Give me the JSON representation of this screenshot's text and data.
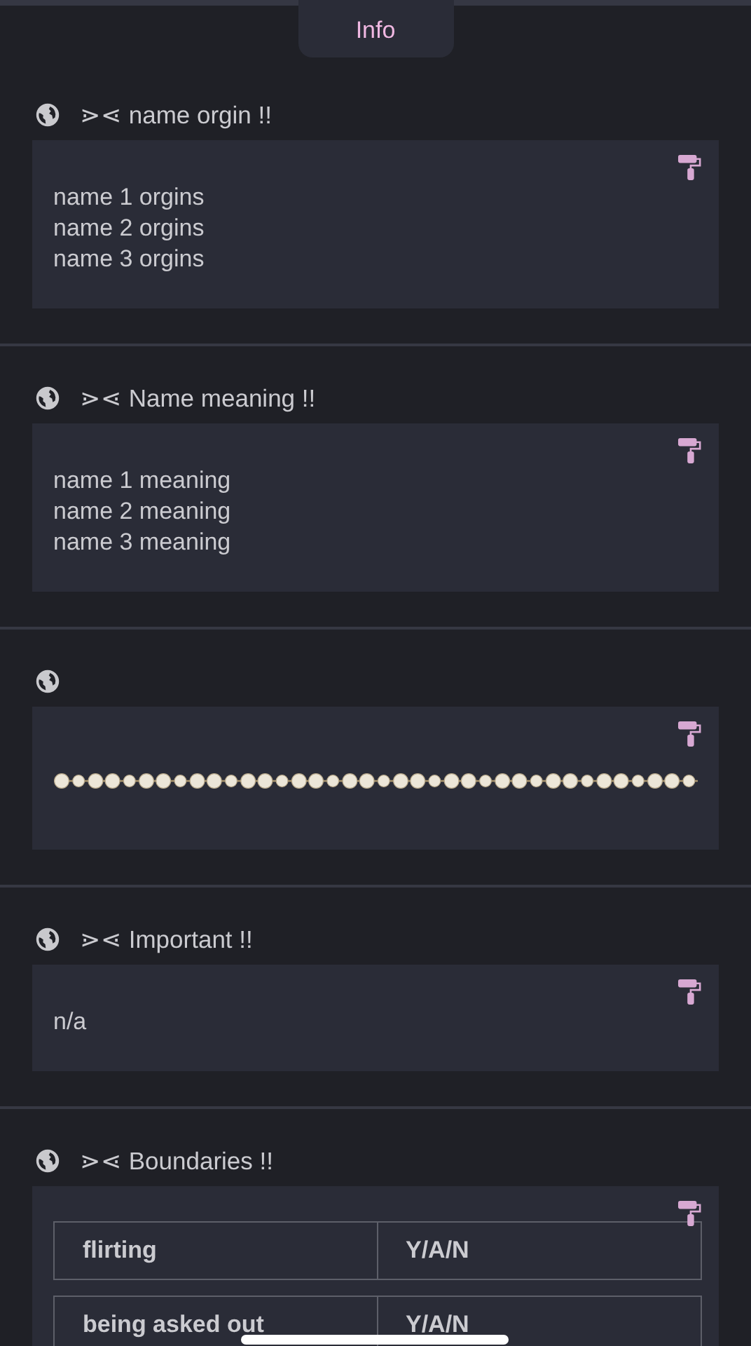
{
  "tab": {
    "label": "Info",
    "selected": true
  },
  "sections": [
    {
      "kind": "text",
      "title": "⋗⋖ name orgin !!",
      "lines": [
        "name 1 orgins",
        "name 2 orgins",
        "name 3 orgins"
      ]
    },
    {
      "kind": "text",
      "title": "⋗⋖ Name meaning !!",
      "lines": [
        "name 1 meaning",
        "name 2 meaning",
        "name 3 meaning"
      ]
    },
    {
      "kind": "pearls"
    },
    {
      "kind": "text",
      "title": "⋗⋖ Important !!",
      "lines": [
        "n/a"
      ]
    },
    {
      "kind": "table",
      "title": "⋗⋖ Boundaries !!",
      "rows": [
        [
          "flirting",
          "Y/A/N"
        ],
        [
          "being asked out",
          "Y/A/N"
        ]
      ]
    }
  ]
}
